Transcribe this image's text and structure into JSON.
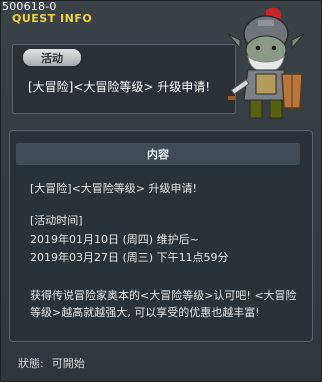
{
  "quest": {
    "id": "500618-0",
    "window_title": "QUEST INFO",
    "tag_label": "活动",
    "name": "[大冒险]<大冒险等级> 升级申请!"
  },
  "content": {
    "header": "内容",
    "lines": [
      "[大冒险]<大冒险等级> 升级申请!",
      "[活动时间]",
      "2019年01月10日 (周四) 维护后~",
      "2019年03月27日 (周三) 下午11点59分",
      "获得传说冒险家奥本的<大冒险等级>认可吧! <大冒险",
      "等级>越高就越强大, 可以享受的优惠也越丰富!"
    ]
  },
  "status": {
    "label": "狀態:",
    "value": "可開始"
  }
}
